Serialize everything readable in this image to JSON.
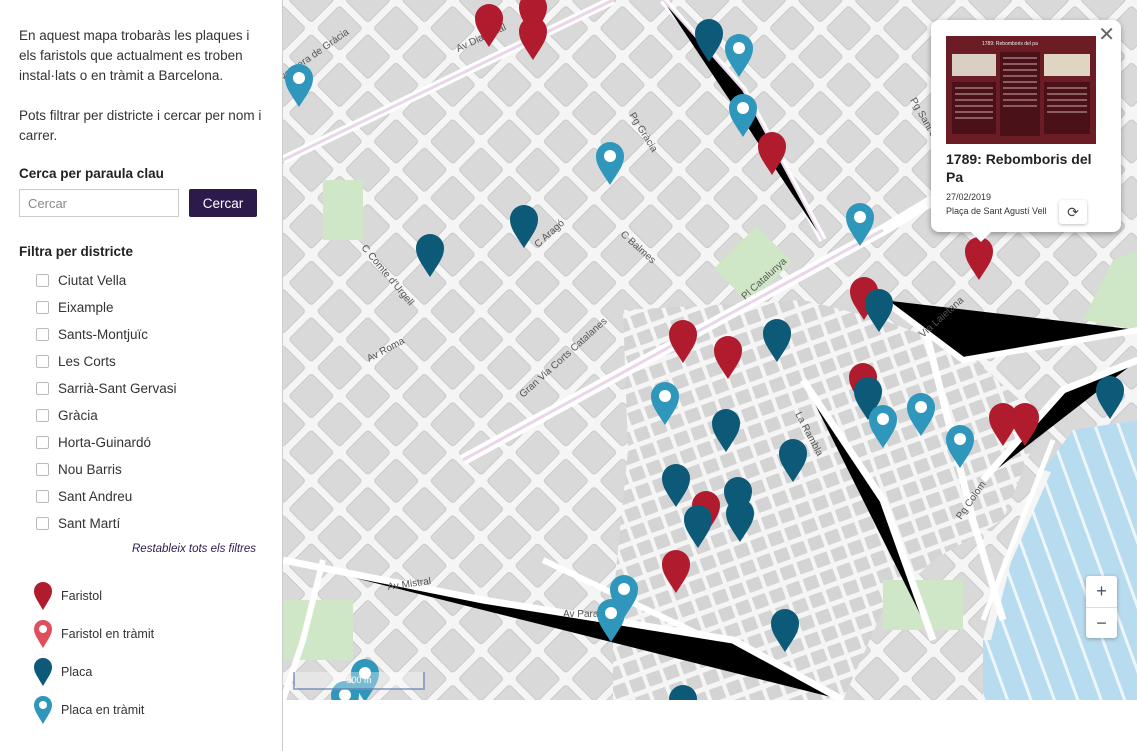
{
  "sidebar": {
    "intro1": "En aquest mapa trobaràs les plaques i els faristols que actualment es troben instal·lats o en tràmit a Barcelona.",
    "intro2": "Pots filtrar per districte i cercar per nom i carrer.",
    "search_heading": "Cerca per paraula clau",
    "search_placeholder": "Cercar",
    "search_button": "Cercar",
    "filter_heading": "Filtra per districte",
    "districts": [
      "Ciutat Vella",
      "Eixample",
      "Sants-Montjuïc",
      "Les Corts",
      "Sarrià-Sant Gervasi",
      "Gràcia",
      "Horta-Guinardó",
      "Nou Barris",
      "Sant Andreu",
      "Sant Martí"
    ],
    "reset": "Restableix tots els filtres",
    "legend": [
      {
        "label": "Faristol",
        "color": "#b01c2e",
        "style": "solid"
      },
      {
        "label": "Faristol en tràmit",
        "color": "#e0505c",
        "style": "dot"
      },
      {
        "label": "Placa",
        "color": "#0c5a78",
        "style": "solid"
      },
      {
        "label": "Placa en tràmit",
        "color": "#2f97bb",
        "style": "dot"
      }
    ]
  },
  "map": {
    "streets": [
      "Av Diagonal",
      "vessera de Gràcia",
      "Pg Gràcia",
      "C Aragó",
      "C Balmes",
      "Pl Catalunya",
      "Gran Via Corts Catalanes",
      "Av Roma",
      "C Comte d'Urgell",
      "La Rambla",
      "Via Laietana",
      "Pg Colom",
      "Av Mistral",
      "Av Paral·lel",
      "Pg Sant Joan"
    ],
    "scale_label": "500 m",
    "zoom_in": "+",
    "zoom_out": "−"
  },
  "popup": {
    "title": "1789: Rebomboris del Pa",
    "date": "27/02/2019",
    "place": "Plaça de Sant Agustí Vell",
    "image_title": "1789: Rebomboris del pa"
  }
}
